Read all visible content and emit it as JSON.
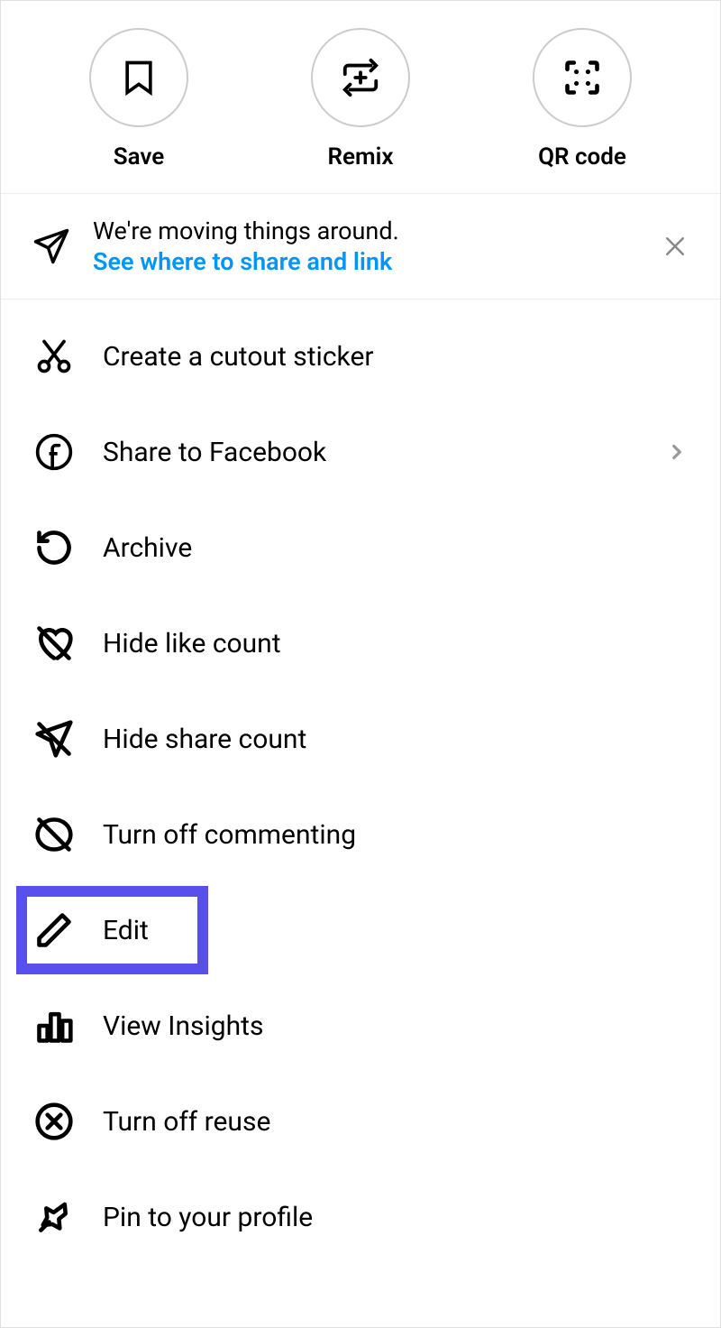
{
  "topActions": {
    "save": "Save",
    "remix": "Remix",
    "qrcode": "QR code"
  },
  "notice": {
    "line1": "We're moving things around.",
    "link": "See where to share and link"
  },
  "menu": {
    "cutout": "Create a cutout sticker",
    "facebook": "Share to Facebook",
    "archive": "Archive",
    "hideLikes": "Hide like count",
    "hideShares": "Hide share count",
    "commenting": "Turn off commenting",
    "edit": "Edit",
    "insights": "View Insights",
    "reuse": "Turn off reuse",
    "pin": "Pin to your profile"
  }
}
